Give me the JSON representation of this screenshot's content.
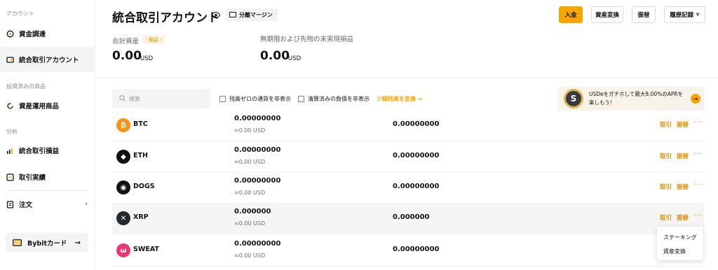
{
  "sidebar": {
    "section_account": "アカウント",
    "section_invest": "投資済みの商品",
    "section_analysis": "分析",
    "items": [
      {
        "label": "資金調達",
        "icon": "coin-circle-icon"
      },
      {
        "label": "統合取引アカウント",
        "icon": "wallet-icon"
      },
      {
        "label": "資産運用商品",
        "icon": "refresh-icon"
      },
      {
        "label": "統合取引損益",
        "icon": "bar-chart-icon"
      },
      {
        "label": "取引実績",
        "icon": "list-box-icon"
      },
      {
        "label": "注文",
        "icon": "document-icon"
      }
    ],
    "card_label": "Bybitカード"
  },
  "header": {
    "title": "統合取引アカウント",
    "margin_badge": "分離マージン",
    "buttons": {
      "deposit": "入金",
      "convert": "資産変換",
      "transfer": "振替",
      "history": "履歴記録"
    }
  },
  "summary": {
    "total_label": "合計資産",
    "pnl_badge": "損益",
    "total_value": "0.00",
    "total_unit": "USD",
    "unrealized_label": "無期限および先物の未実現損益",
    "unrealized_value": "0.00",
    "unrealized_unit": "USD"
  },
  "filters": {
    "search_placeholder": "検索",
    "hide_zero": "残高ゼロの通貨を非表示",
    "hide_liquidated": "清算済みの負債を非表示",
    "small_convert": "少額残高を変換"
  },
  "promo": {
    "text": "USDeをガチホして最大8.00%のAPRを楽しもう！"
  },
  "assets": [
    {
      "symbol": "BTC",
      "amount": "0.00000000",
      "usd": "≈0.00 USD",
      "equity": "0.00000000",
      "color": "#f7931a",
      "icon": "btc-icon",
      "glyph": "₿"
    },
    {
      "symbol": "ETH",
      "amount": "0.00000000",
      "usd": "≈0.00 USD",
      "equity": "0.00000000",
      "color": "#121214",
      "icon": "eth-icon",
      "glyph": "◆"
    },
    {
      "symbol": "DOGS",
      "amount": "0.00000000",
      "usd": "≈0.00 USD",
      "equity": "0.00000000",
      "color": "#121214",
      "icon": "dogs-icon",
      "glyph": "◉"
    },
    {
      "symbol": "XRP",
      "amount": "0.000000",
      "usd": "≈0.00 USD",
      "equity": "0.000000",
      "color": "#23292f",
      "icon": "xrp-icon",
      "glyph": "✕"
    },
    {
      "symbol": "SWEAT",
      "amount": "0.00000000",
      "usd": "≈0.00 USD",
      "equity": "0.00000000",
      "color": "#e6397a",
      "icon": "sweat-icon",
      "glyph": "ω"
    }
  ],
  "row_actions": {
    "trade": "取引",
    "transfer": "振替"
  },
  "dropdown": {
    "items": [
      "ステーキング",
      "資産変換"
    ]
  },
  "colors": {
    "accent": "#f7a600",
    "action_text": "#e08e00"
  }
}
